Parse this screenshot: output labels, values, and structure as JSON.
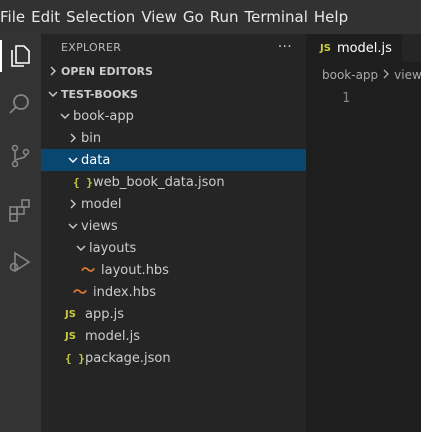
{
  "menu": [
    "File",
    "Edit",
    "Selection",
    "View",
    "Go",
    "Run",
    "Terminal",
    "Help"
  ],
  "activity_bar": [
    "files-icon",
    "search-icon",
    "source-control-icon",
    "extensions-icon",
    "run-debug-icon"
  ],
  "explorer": {
    "title": "EXPLORER",
    "more": "···",
    "open_editors_label": "OPEN EDITORS",
    "workspace_label": "TEST-BOOKS",
    "tree": [
      {
        "label": "book-app",
        "type": "folder",
        "expanded": true
      },
      {
        "label": "bin",
        "type": "folder",
        "expanded": false
      },
      {
        "label": "data",
        "type": "folder",
        "expanded": true,
        "selected": true
      },
      {
        "label": "web_book_data.json",
        "type": "json"
      },
      {
        "label": "model",
        "type": "folder",
        "expanded": false
      },
      {
        "label": "views",
        "type": "folder",
        "expanded": true
      },
      {
        "label": "layouts",
        "type": "folder",
        "expanded": true
      },
      {
        "label": "layout.hbs",
        "type": "hbs"
      },
      {
        "label": "index.hbs",
        "type": "hbs"
      },
      {
        "label": "app.js",
        "type": "js"
      },
      {
        "label": "model.js",
        "type": "js"
      },
      {
        "label": "package.json",
        "type": "json"
      }
    ]
  },
  "editor": {
    "tab_icon": "JS",
    "tab_label": "model.js",
    "breadcrumb": [
      "book-app",
      "view"
    ],
    "line_number": "1"
  },
  "icons": {
    "js_badge": "JS",
    "json_badge": "{ }",
    "hbs_badge": "〜"
  },
  "colors": {
    "selection": "#094771",
    "sidebar": "#252526",
    "activity": "#333333",
    "menubar": "#323233",
    "js_yellow": "#cbcb41",
    "hbs_orange": "#e37933"
  }
}
